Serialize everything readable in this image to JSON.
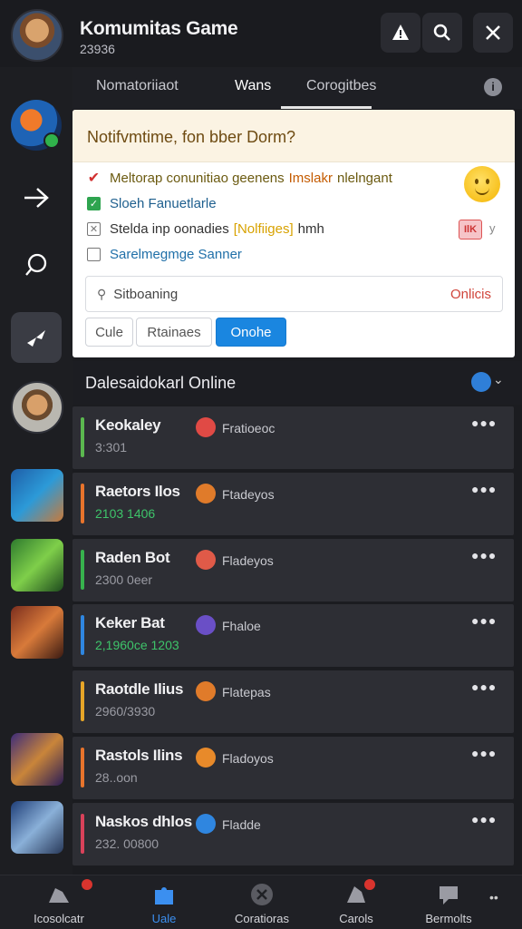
{
  "header": {
    "title": "Komumitas Game",
    "subtitle": "23936",
    "buttons": {
      "alert_icon": "alert-icon",
      "search_icon": "search-icon",
      "close_icon": "close-icon"
    }
  },
  "tabs": [
    {
      "label": "Nomatoriiaot"
    },
    {
      "label": "Wans"
    },
    {
      "label": "Corogitbes"
    }
  ],
  "notification": {
    "title": "Notifvmtime, fon bber Dorm?",
    "options": [
      {
        "text": "Meltorap conunitiao geenens",
        "highlight": "Imslakr",
        "tail": "nlelngant"
      },
      {
        "text": "Sloeh Fanuetlarle"
      },
      {
        "text": "Stelda inp oonadies",
        "highlight": "[Nolfiiges]",
        "tail": "hmh"
      },
      {
        "text": "Sarelmegmge Sanner"
      }
    ],
    "badge": "IlK",
    "badge_aside": "y",
    "field": {
      "value": "Sitboaning",
      "action": "Onlicis"
    },
    "buttons": [
      "Cule",
      "Rtainaes",
      "Onohe"
    ]
  },
  "online": {
    "title": "Dalesaidokarl Online",
    "players": [
      {
        "name": "Keokaley",
        "meta": "3:301",
        "status": "Fratioeoc",
        "bar": "#5bb84f",
        "meta_green": false,
        "status_color": "#e04a45"
      },
      {
        "name": "Raetors Ilos",
        "meta": "2103 1406",
        "status": "Ftadeyos",
        "bar": "#e8742c",
        "meta_green": true,
        "status_color": "#e07b2a"
      },
      {
        "name": "Raden Bot",
        "meta": "2300 0eer",
        "status": "Fladeyos",
        "bar": "#37b24d",
        "meta_green": false,
        "status_color": "#e05a48"
      },
      {
        "name": "Keker Bat",
        "meta": "2,1960ce 1203",
        "status": "Fhaloe",
        "bar": "#2f86e0",
        "meta_green": true,
        "status_color": "#6a4fc6"
      },
      {
        "name": "Raotdle Ilius",
        "meta": "2960/3930",
        "status": "Flatepas",
        "bar": "#e7a628",
        "meta_green": false,
        "status_color": "#e07b2a"
      },
      {
        "name": "Rastols Ilins",
        "meta": "28..oon",
        "status": "Fladoyos",
        "bar": "#e8742c",
        "meta_green": false,
        "status_color": "#e88a2a"
      },
      {
        "name": "Naskos dhlos",
        "meta": "232. 00800",
        "status": "Fladde",
        "bar": "#d9425a",
        "meta_green": false,
        "status_color": "#2f86e0"
      }
    ]
  },
  "bottom_nav": [
    {
      "label": "Icosolcatr",
      "icon": "game-icon",
      "badge": true
    },
    {
      "label": "Uale",
      "icon": "puzzle-icon",
      "badge": false
    },
    {
      "label": "Coratioras",
      "icon": "close-circle-icon",
      "badge": false
    },
    {
      "label": "Carols",
      "icon": "cards-icon",
      "badge": true
    },
    {
      "label": "Bermolts",
      "icon": "chat-icon",
      "badge": false
    }
  ],
  "colors": {
    "accent": "#1a86e0",
    "panel_head": "#fbf3e3",
    "background": "#1b1c20"
  }
}
